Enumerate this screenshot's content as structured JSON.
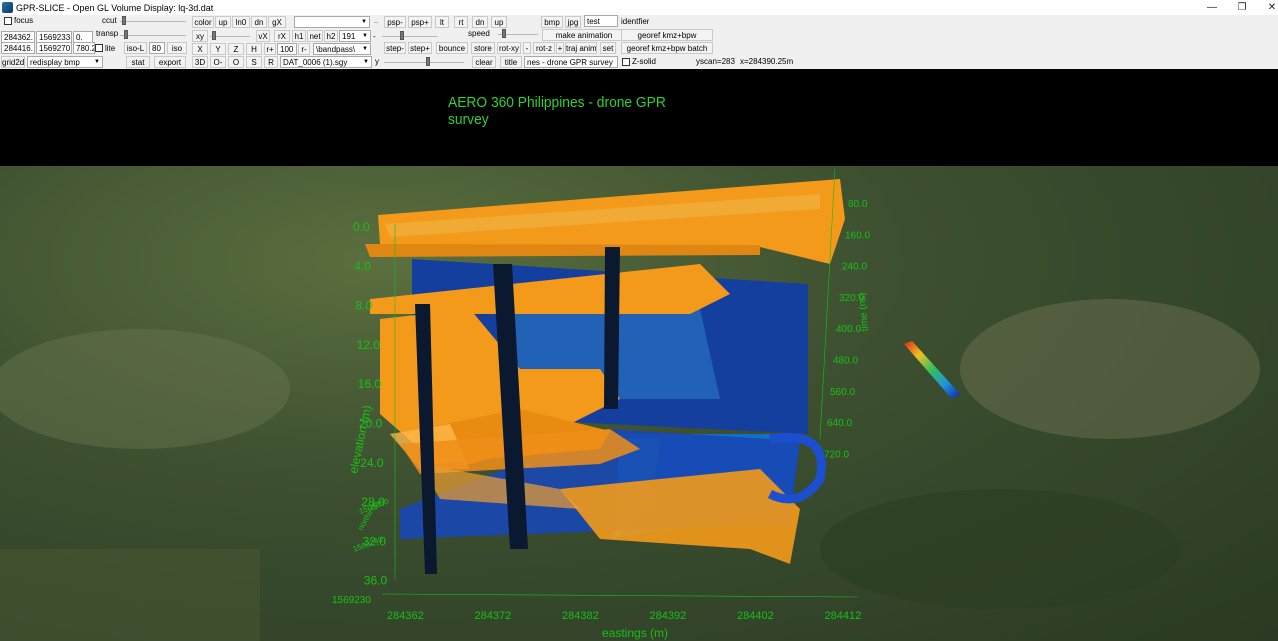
{
  "window": {
    "title": "GPR-SLICE -  Open GL Volume Display:   lq-3d.dat",
    "minimize": "—",
    "restore": "❐",
    "close": "✕"
  },
  "controls": {
    "focus": "focus",
    "ccut": "ccut",
    "transp": "transp",
    "coord1": [
      "284362.",
      "1569233",
      "0."
    ],
    "coord2": [
      "284416.",
      "1569270",
      "780.2"
    ],
    "lite": "lite",
    "iso_l": "iso-L",
    "iso_val": "80",
    "iso": "iso",
    "grid2d": "grid2d",
    "redisplay": "redisplay bmp",
    "stat": "stat",
    "export": "export",
    "color": "color",
    "up": "up",
    "ln0": "ln0",
    "dn": "dn",
    "gX": "gX",
    "xy": "xy",
    "vX": "vX",
    "rX": "rX",
    "h1": "h1",
    "net": "net",
    "h2": "h2",
    "h2_val": "191",
    "X": "X",
    "Y": "Y",
    "Z": "Z",
    "H": "H",
    "r_plus": "r+",
    "r_val": "100",
    "r_minus": "r-",
    "bandpass": "\\bandpass\\",
    "d3": "3D",
    "O_minus": "O-",
    "O": "O",
    "S": "S",
    "R": "R",
    "file": "DAT_0006 (1).sgy",
    "y": "y",
    "psp_minus": "psp-",
    "psp_plus": "psp+",
    "lt": "lt",
    "rt": "rt",
    "dn2": "dn",
    "up2": "up",
    "speed": "speed",
    "step_minus": "step-",
    "step_plus": "step+",
    "bounce": "bounce",
    "store": "store",
    "rot_xy": "rot-xy",
    "minus": "-",
    "rot_z": "rot-z",
    "plus": "+",
    "traj_anim": "traj anim",
    "set": "set",
    "clear": "clear",
    "title_btn": "title",
    "title_val": "nes - drone GPR survey",
    "bmp": "bmp",
    "jpg": "jpg",
    "test": "test",
    "identifier": "identfier",
    "make_animation": "make animation",
    "georef": "georef kmz+bpw",
    "georef_batch": "georef kmz+bpw batch",
    "zsolid": "Z-solid",
    "yscan": "yscan=283",
    "xpos": "x=284390.25m"
  },
  "scene": {
    "title": "AERO 360 Philippines - drone GPR survey",
    "elevation_label": "elevation (m)",
    "elevation_ticks": [
      "0.0",
      "4.0",
      "8.0",
      "12.0",
      "16.0",
      "20.0",
      "24.0",
      "28.0",
      "32.0",
      "36.0"
    ],
    "time_label": "time (ns)",
    "time_ticks": [
      "80.0",
      "160.0",
      "240.0",
      "320.0",
      "400.0",
      "480.0",
      "560.0",
      "640.0",
      "720.0"
    ],
    "easting_label": "eastings (m)",
    "easting_ticks": [
      "284362",
      "284372",
      "284382",
      "284392",
      "284402",
      "284412"
    ],
    "northing_label": "northings",
    "northing_ticks": [
      "1569250",
      "1569240"
    ],
    "northing_corner": "1569230",
    "colors": {
      "surface": "#f39a1a",
      "high": "#ffb030",
      "mid": "#1fa3d8",
      "low": "#123e9e",
      "axis": "#18c018"
    }
  }
}
